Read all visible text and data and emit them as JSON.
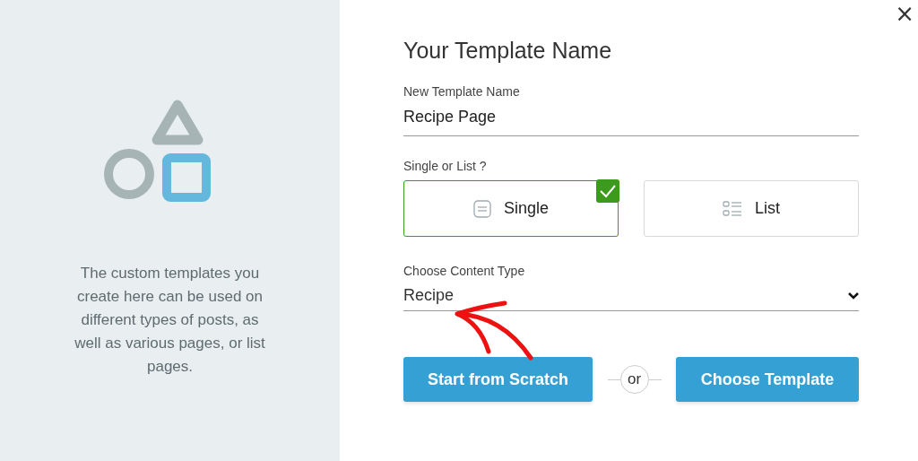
{
  "side_panel": {
    "description": "The custom templates you create here can be used on different types of posts, as well as various pages, or list pages."
  },
  "close": {
    "icon": "×"
  },
  "title": "Your Template Name",
  "name_field": {
    "label": "New Template Name",
    "value": "Recipe Page"
  },
  "type_choice": {
    "label": "Single or List ?",
    "options": [
      {
        "kind": "single",
        "label": "Single",
        "selected": true
      },
      {
        "kind": "list",
        "label": "List",
        "selected": false
      }
    ]
  },
  "content_type": {
    "label": "Choose Content Type",
    "value": "Recipe"
  },
  "actions": {
    "primary": "Start from Scratch",
    "separator": "or",
    "secondary": "Choose Template"
  }
}
